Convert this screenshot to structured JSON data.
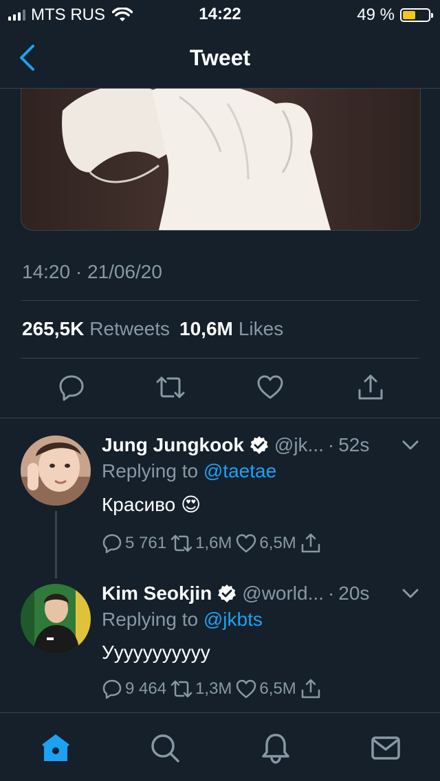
{
  "status_bar": {
    "carrier": "MTS RUS",
    "time": "14:22",
    "battery_percent": "49 %",
    "battery_level": 0.49
  },
  "nav": {
    "title": "Tweet"
  },
  "tweet": {
    "timestamp": "14:20 · 21/06/20",
    "retweets_count": "265,5K",
    "retweets_label": "Retweets",
    "likes_count": "10,6M",
    "likes_label": "Likes"
  },
  "replies": [
    {
      "name": "Jung Jungkook",
      "handle": "@jk...",
      "time": "52s",
      "replying_prefix": "Replying to",
      "replying_to": "@taetae",
      "text": "Красиво 😍",
      "replies": "5 761",
      "retweets": "1,6M",
      "likes": "6,5M"
    },
    {
      "name": "Kim Seokjin",
      "handle": "@world...",
      "time": "20s",
      "replying_prefix": "Replying to",
      "replying_to": "@jkbts",
      "text": "Ууууууууууу",
      "replies": "9 464",
      "retweets": "1,3M",
      "likes": "6,5M"
    }
  ],
  "tabbar": {
    "items": [
      "home-icon",
      "search-icon",
      "notifications-icon",
      "messages-icon"
    ],
    "active": "home-icon"
  },
  "colors": {
    "background": "#15202b",
    "accent": "#1da1f2",
    "secondary_text": "#8899a6",
    "divider": "#38444d",
    "battery": "#f5c518"
  }
}
